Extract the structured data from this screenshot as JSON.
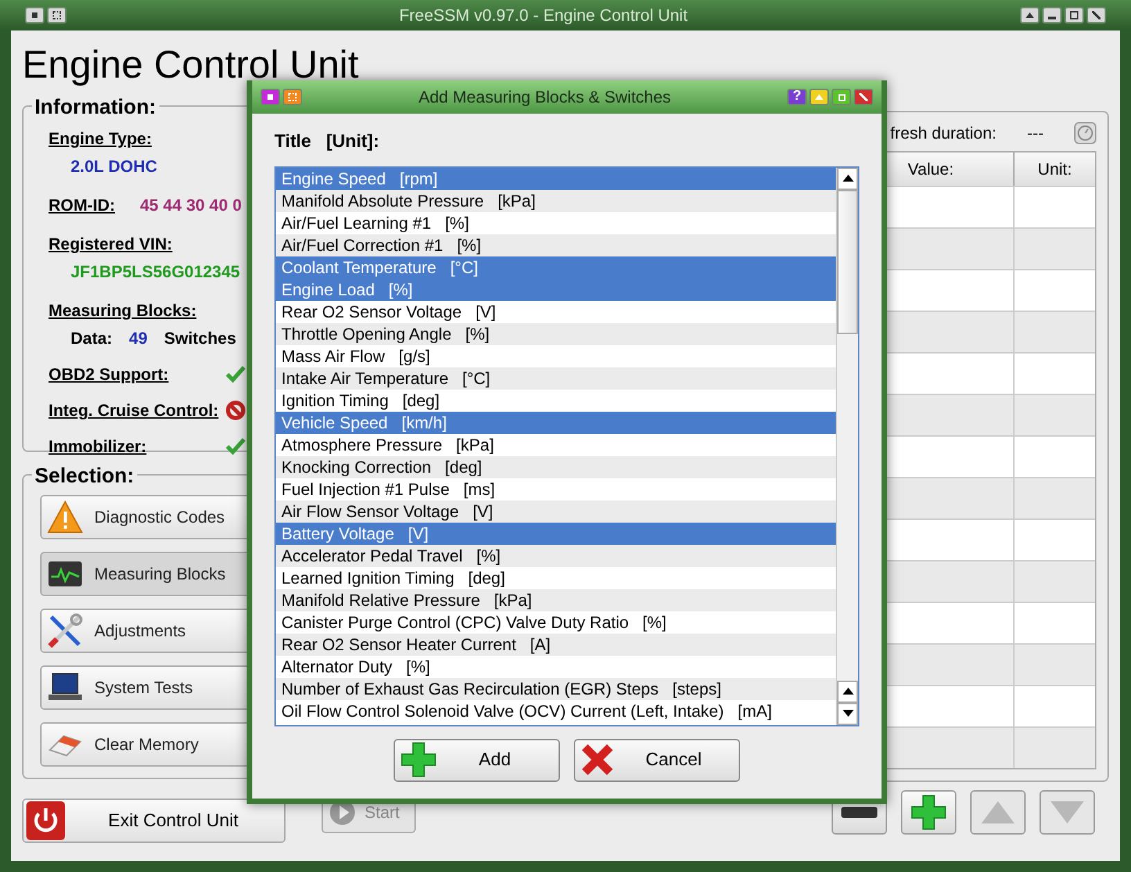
{
  "window": {
    "title": "FreeSSM v0.97.0 - Engine Control Unit"
  },
  "heading": "Engine Control Unit",
  "information": {
    "title": "Information:",
    "engine_type": {
      "label": "Engine Type:",
      "value": "2.0L DOHC"
    },
    "rom_id": {
      "label": "ROM-ID:",
      "value": "45 44 30 40 0"
    },
    "vin": {
      "label": "Registered VIN:",
      "value": "JF1BP5LS56G012345"
    },
    "measuring_blocks": {
      "label": "Measuring Blocks:",
      "data_label": "Data:",
      "data_value": "49",
      "switches_label": "Switches"
    },
    "features": [
      {
        "label": "OBD2 Support:",
        "supported": true
      },
      {
        "label": "Integ. Cruise Control:",
        "supported": false
      },
      {
        "label": "Immobilizer:",
        "supported": true
      }
    ]
  },
  "selection": {
    "title": "Selection:",
    "buttons": [
      {
        "label": "Diagnostic Codes",
        "kind": "warning",
        "selected": false
      },
      {
        "label": "Measuring Blocks",
        "kind": "monitor",
        "selected": true
      },
      {
        "label": "Adjustments",
        "kind": "tools",
        "selected": false
      },
      {
        "label": "System Tests",
        "kind": "laptop",
        "selected": false
      },
      {
        "label": "Clear Memory",
        "kind": "eraser",
        "selected": false
      }
    ]
  },
  "exit_button": "Exit Control Unit",
  "measuring_panel": {
    "refresh_label": "fresh duration:",
    "refresh_value": "---",
    "table": {
      "columns": [
        "Value:",
        "Unit:"
      ]
    },
    "start_button": {
      "label": "Start",
      "disabled": true
    },
    "tool_buttons": [
      {
        "kind": "remove",
        "disabled": false
      },
      {
        "kind": "add",
        "disabled": false
      },
      {
        "kind": "up",
        "disabled": true
      },
      {
        "kind": "down",
        "disabled": true
      }
    ]
  },
  "dialog": {
    "title": "Add Measuring Blocks & Switches",
    "help_button": "?",
    "list_header": "Title   [Unit]:",
    "items": [
      {
        "text": "Engine Speed   [rpm]",
        "selected": true
      },
      {
        "text": "Manifold Absolute Pressure   [kPa]",
        "selected": false
      },
      {
        "text": "Air/Fuel Learning #1   [%]",
        "selected": false
      },
      {
        "text": "Air/Fuel Correction #1   [%]",
        "selected": false
      },
      {
        "text": "Coolant Temperature   [°C]",
        "selected": true
      },
      {
        "text": "Engine Load   [%]",
        "selected": true
      },
      {
        "text": "Rear O2 Sensor Voltage   [V]",
        "selected": false
      },
      {
        "text": "Throttle Opening Angle   [%]",
        "selected": false
      },
      {
        "text": "Mass Air Flow   [g/s]",
        "selected": false
      },
      {
        "text": "Intake Air Temperature   [°C]",
        "selected": false
      },
      {
        "text": "Ignition Timing   [deg]",
        "selected": false
      },
      {
        "text": "Vehicle Speed   [km/h]",
        "selected": true
      },
      {
        "text": "Atmosphere Pressure   [kPa]",
        "selected": false
      },
      {
        "text": "Knocking Correction   [deg]",
        "selected": false
      },
      {
        "text": "Fuel Injection #1 Pulse   [ms]",
        "selected": false
      },
      {
        "text": "Air Flow Sensor Voltage   [V]",
        "selected": false
      },
      {
        "text": "Battery Voltage   [V]",
        "selected": true
      },
      {
        "text": "Accelerator Pedal Travel   [%]",
        "selected": false
      },
      {
        "text": "Learned Ignition Timing   [deg]",
        "selected": false
      },
      {
        "text": "Manifold Relative Pressure   [kPa]",
        "selected": false
      },
      {
        "text": "Canister Purge Control (CPC) Valve Duty Ratio   [%]",
        "selected": false
      },
      {
        "text": "Rear O2 Sensor Heater Current   [A]",
        "selected": false
      },
      {
        "text": "Alternator Duty   [%]",
        "selected": false
      },
      {
        "text": "Number of Exhaust Gas Recirculation (EGR) Steps   [steps]",
        "selected": false
      },
      {
        "text": "Oil Flow Control Solenoid Valve (OCV) Current (Left, Intake)   [mA]",
        "selected": false
      }
    ],
    "add_button": "Add",
    "cancel_button": "Cancel"
  }
}
